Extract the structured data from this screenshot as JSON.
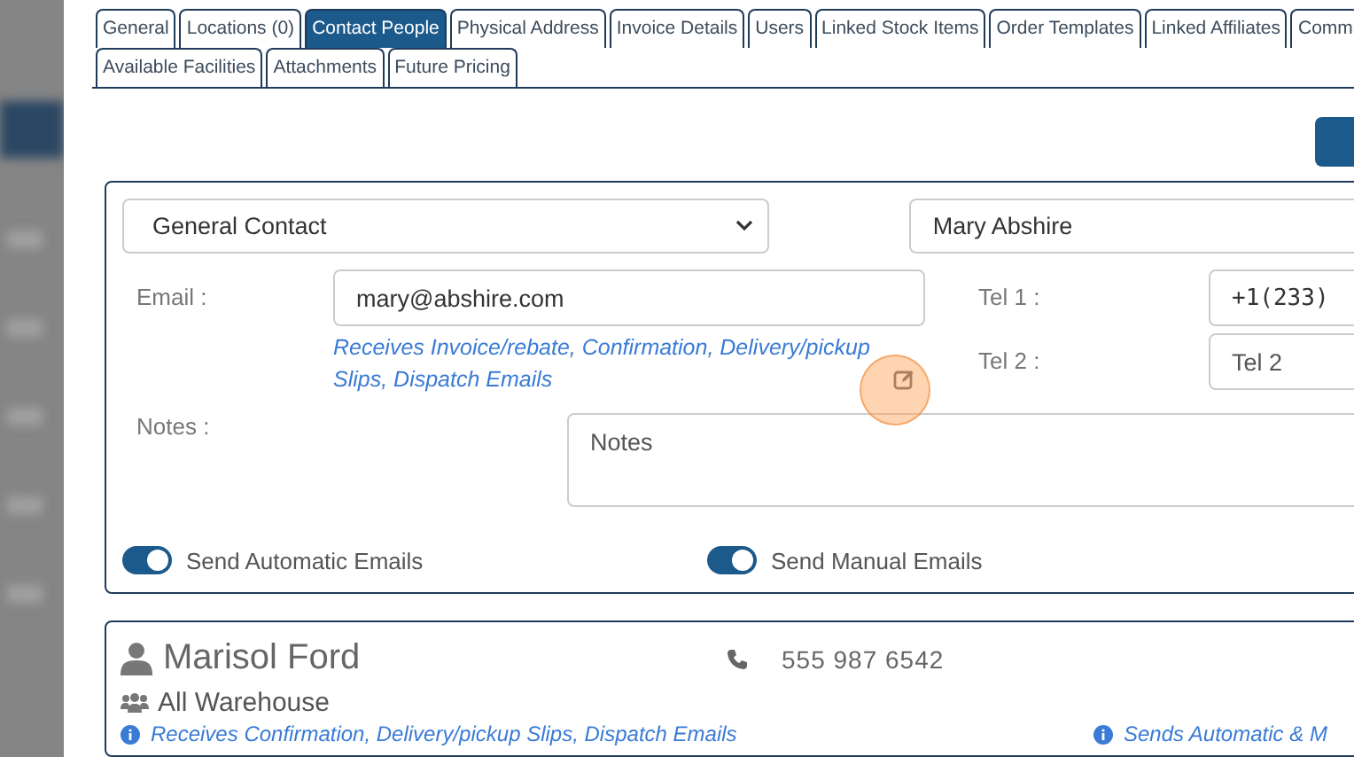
{
  "tabs": [
    [
      {
        "label": "General",
        "selected": false
      },
      {
        "label": "Locations (0)",
        "selected": false
      },
      {
        "label": "Contact People",
        "selected": true
      },
      {
        "label": "Physical Address",
        "selected": false
      },
      {
        "label": "Invoice Details",
        "selected": false
      },
      {
        "label": "Users",
        "selected": false
      },
      {
        "label": "Linked Stock Items",
        "selected": false
      },
      {
        "label": "Order Templates",
        "selected": false
      },
      {
        "label": "Linked Affiliates",
        "selected": false
      },
      {
        "label": "Comm",
        "selected": false
      }
    ],
    [
      {
        "label": "Available Facilities",
        "selected": false
      },
      {
        "label": "Attachments",
        "selected": false
      },
      {
        "label": "Future Pricing",
        "selected": false
      }
    ]
  ],
  "contact_form": {
    "type_select": {
      "value": "General Contact"
    },
    "name_field": {
      "value": "Mary Abshire"
    },
    "email": {
      "label": "Email :",
      "value": "mary@abshire.com"
    },
    "email_types_link": "Receives Invoice/rebate, Confirmation, Delivery/pickup Slips, Dispatch Emails",
    "tel_1": {
      "label": "Tel 1 :",
      "value": "+1(233)"
    },
    "tel_2": {
      "label": "Tel 2 :",
      "placeholder": "Tel 2"
    },
    "notes": {
      "label": "Notes :",
      "placeholder": "Notes"
    },
    "toggles": [
      {
        "label": "Send Automatic Emails",
        "on": true
      },
      {
        "label": "Send Manual Emails",
        "on": true
      }
    ]
  },
  "contacts": [
    {
      "name": "Marisol Ford",
      "phone": "555 987 6542",
      "group": "All Warehouse",
      "email_types": "Receives Confirmation, Delivery/pickup Slips, Dispatch Emails",
      "send_mode": "Sends Automatic & M"
    }
  ]
}
